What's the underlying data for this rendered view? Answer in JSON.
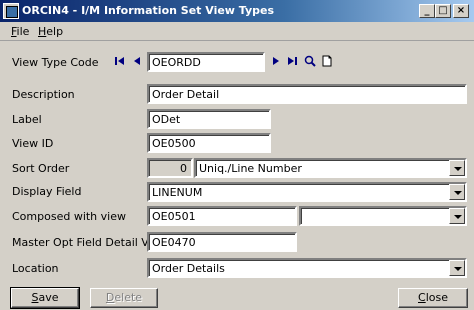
{
  "window": {
    "title": "ORCIN4 - I/M Information Set View Types",
    "controls": {
      "minimize": "_",
      "maximize": "□",
      "close": "×"
    }
  },
  "menu": [
    {
      "label": "File",
      "accel": "F",
      "rest": "ile"
    },
    {
      "label": "Help",
      "accel": "H",
      "rest": "elp"
    }
  ],
  "form": {
    "view_type_code": {
      "label": "View Type Code",
      "value": "OEORDD"
    },
    "description": {
      "label": "Description",
      "value": "Order Detail"
    },
    "label": {
      "label": "Label",
      "value": "ODet"
    },
    "view_id": {
      "label": "View ID",
      "value": "OE0500"
    },
    "sort_order": {
      "label": "Sort Order",
      "number": "0",
      "selected": "Uniq./Line Number"
    },
    "display_field": {
      "label": "Display Field",
      "selected": "LINENUM"
    },
    "composed_with_view": {
      "label": "Composed with view",
      "value": "OE0501",
      "selected": ""
    },
    "master_opt_field_detail_view": {
      "label": "Master Opt Field Detail View",
      "value": "OE0470"
    },
    "location": {
      "label": "Location",
      "selected": "Order Details"
    }
  },
  "buttons": {
    "save": {
      "label": "Save",
      "accel": "S",
      "rest": "ave"
    },
    "delete": {
      "label": "Delete",
      "accel": "D",
      "rest": "elete"
    },
    "close": {
      "label": "Close",
      "accel": "C",
      "rest": "lose"
    }
  },
  "icons": [
    "first-record-icon",
    "previous-record-icon",
    "next-record-icon",
    "last-record-icon",
    "finder-icon",
    "new-document-icon"
  ]
}
